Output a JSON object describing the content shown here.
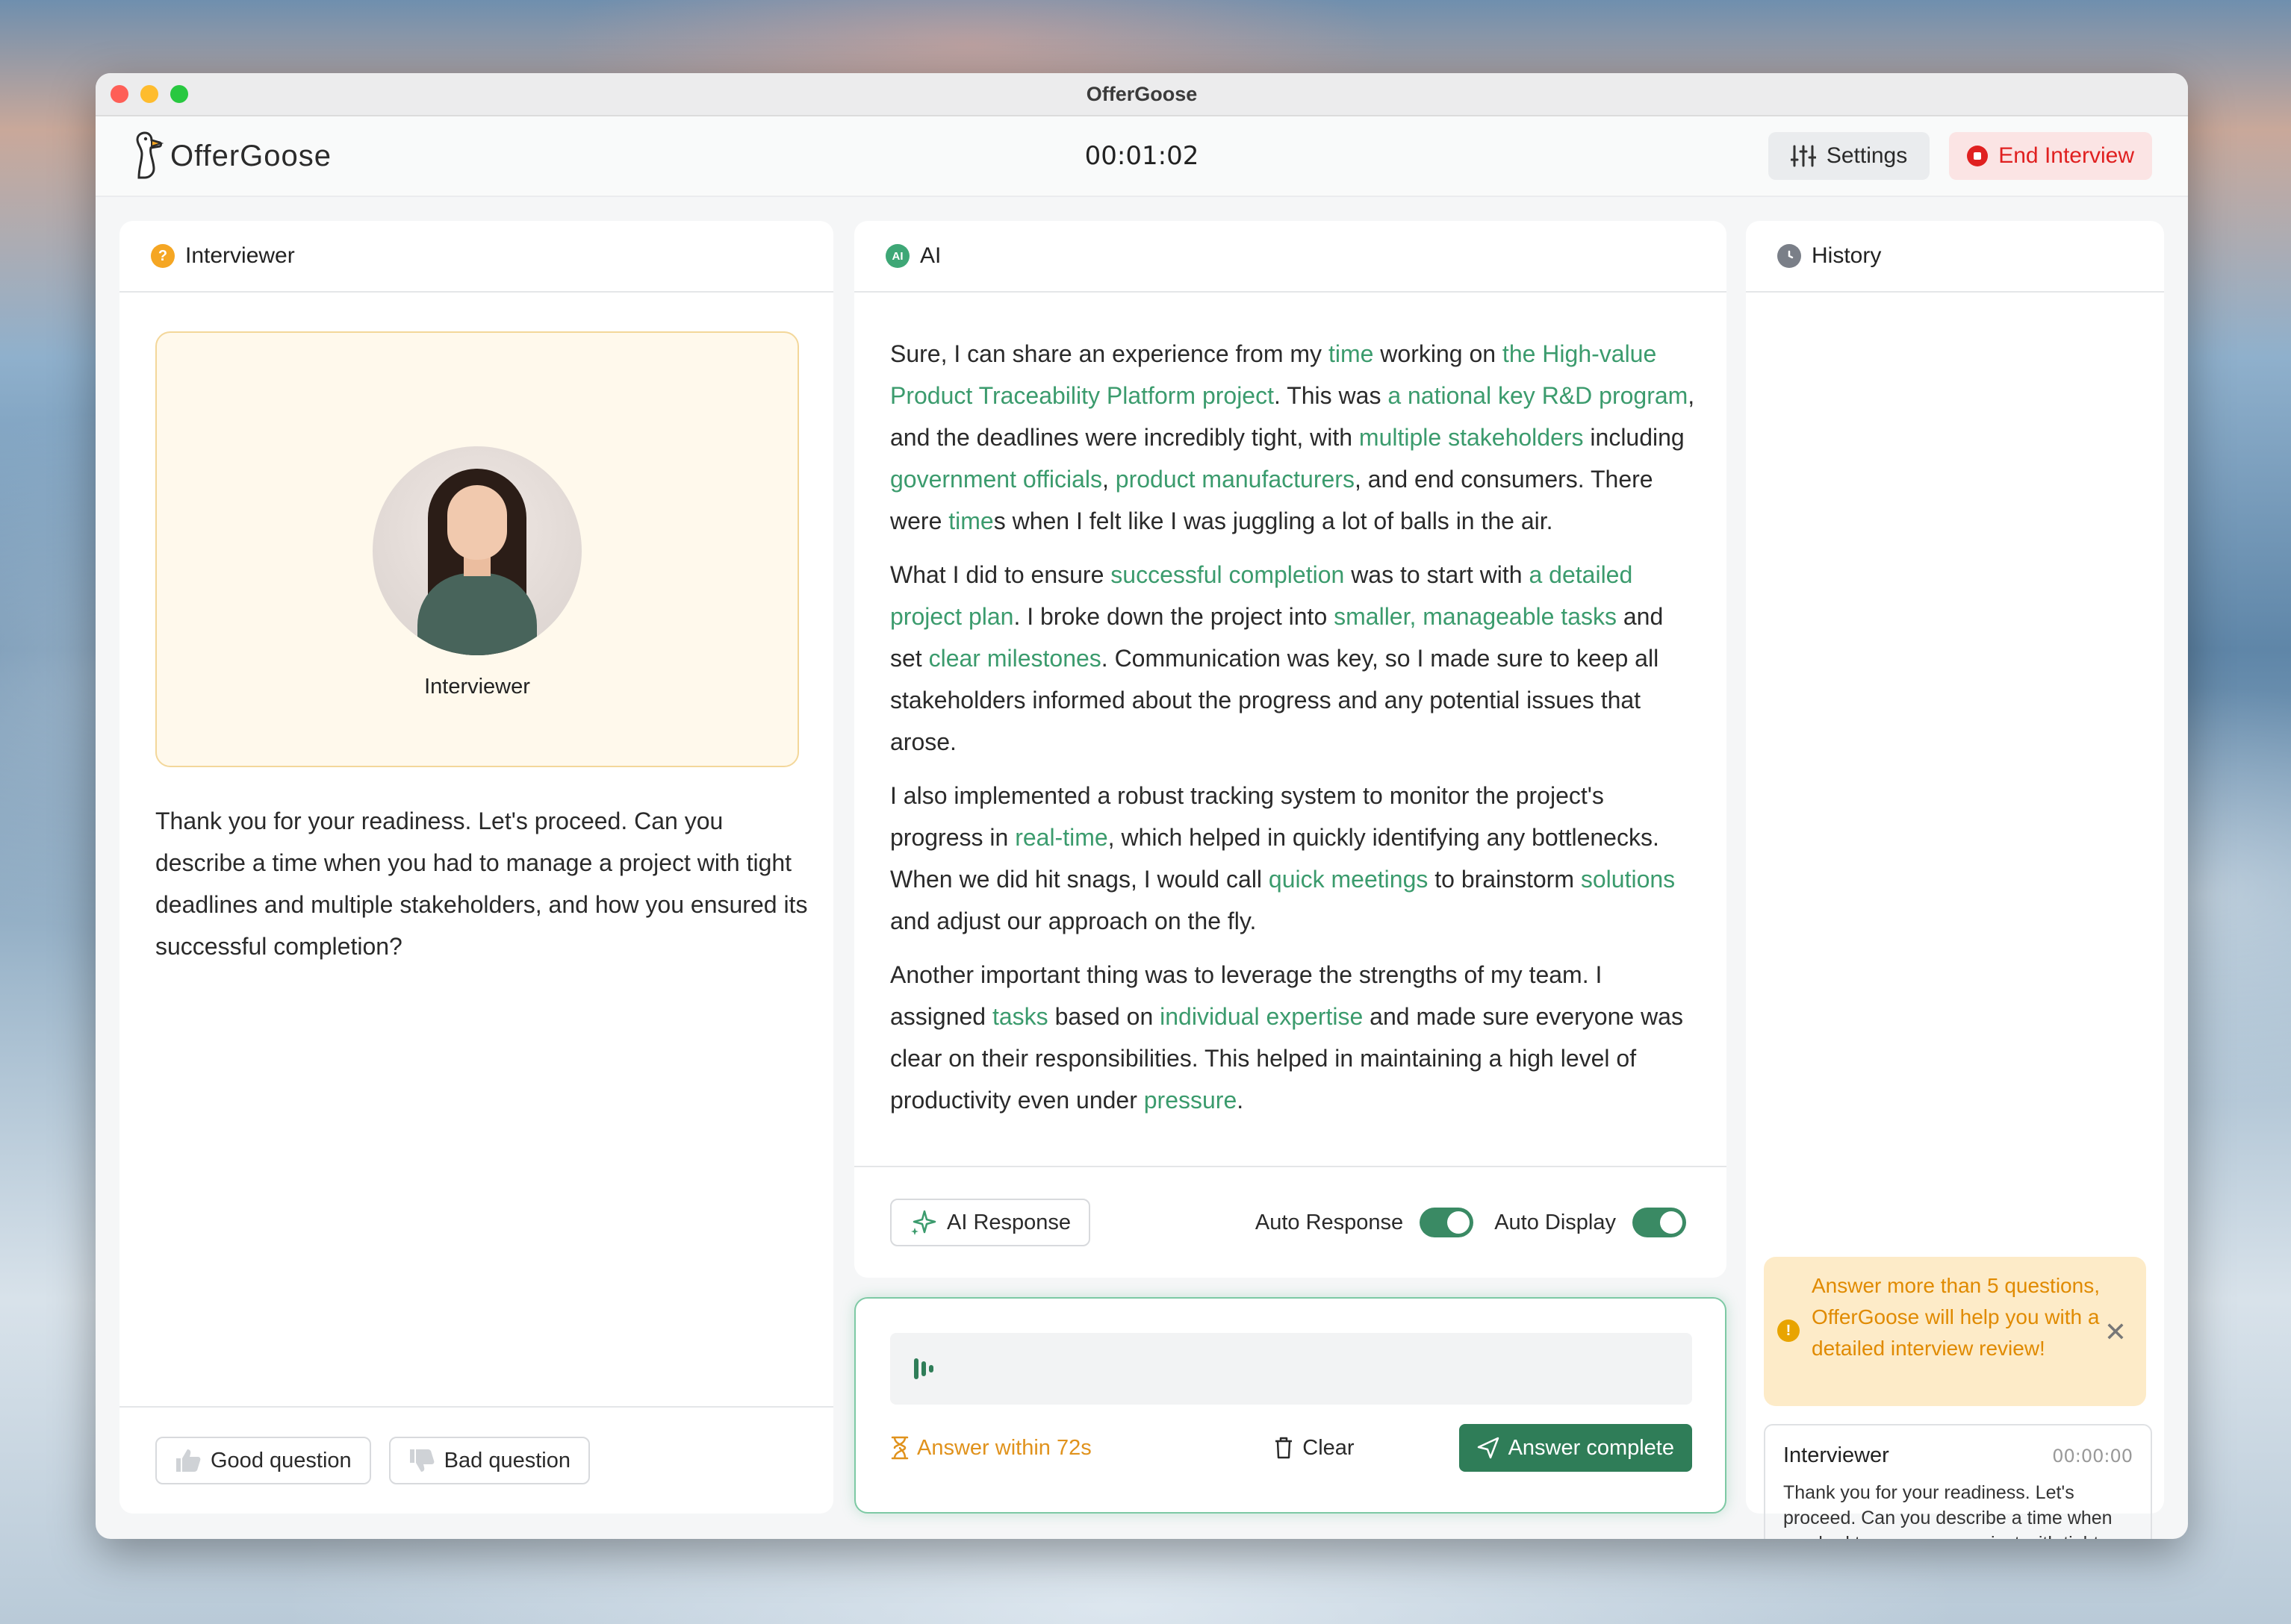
{
  "window": {
    "title": "OfferGoose"
  },
  "app": {
    "brand": "OfferGoose",
    "timer": "00:01:02",
    "settings_label": "Settings",
    "end_label": "End Interview"
  },
  "interviewer_panel": {
    "title": "Interviewer",
    "avatar_label": "Interviewer",
    "question": "Thank you for your readiness. Let's proceed. Can you describe a time when you had to manage a project with tight deadlines and multiple stakeholders, and how you ensured its successful completion?",
    "good_label": "Good question",
    "bad_label": "Bad question"
  },
  "ai_panel": {
    "title": "AI",
    "paragraphs": [
      [
        {
          "t": "Sure, I can share an experience from my "
        },
        {
          "t": "time",
          "h": true
        },
        {
          "t": " working on "
        },
        {
          "t": "the High-value Product Traceability Platform project",
          "h": true
        },
        {
          "t": ". This was "
        },
        {
          "t": "a national key R&D program",
          "h": true
        },
        {
          "t": ", and the deadlines were incredibly tight, with "
        },
        {
          "t": "multiple stakeholders",
          "h": true
        },
        {
          "t": " including "
        },
        {
          "t": "government officials",
          "h": true
        },
        {
          "t": ", "
        },
        {
          "t": "product manufacturers",
          "h": true
        },
        {
          "t": ", and end consumers. There were "
        },
        {
          "t": "time",
          "h": true
        },
        {
          "t": "s when I felt like I was juggling a lot of balls in the air."
        }
      ],
      [
        {
          "t": "What I did to ensure "
        },
        {
          "t": "successful completion",
          "h": true
        },
        {
          "t": " was to start with "
        },
        {
          "t": "a detailed project plan",
          "h": true
        },
        {
          "t": ". I broke down the project into "
        },
        {
          "t": "smaller, manageable tasks",
          "h": true
        },
        {
          "t": " and set "
        },
        {
          "t": "clear milestones",
          "h": true
        },
        {
          "t": ". Communication was key, so I made sure to keep all stakeholders informed about the progress and any potential issues that arose."
        }
      ],
      [
        {
          "t": "I also implemented a robust tracking system to monitor the project's progress in "
        },
        {
          "t": "real-time",
          "h": true
        },
        {
          "t": ", which helped in quickly identifying any bottlenecks. When we did hit snags, I would call "
        },
        {
          "t": "quick meetings",
          "h": true
        },
        {
          "t": " to brainstorm "
        },
        {
          "t": "solutions",
          "h": true
        },
        {
          "t": " and adjust our approach on the fly."
        }
      ],
      [
        {
          "t": "Another important thing was to leverage the strengths of my team. I assigned "
        },
        {
          "t": "tasks",
          "h": true
        },
        {
          "t": " based on "
        },
        {
          "t": "individual expertise",
          "h": true
        },
        {
          "t": " and made sure everyone was clear on their responsibilities. This helped in maintaining a high level of productivity even under "
        },
        {
          "t": "pressure",
          "h": true
        },
        {
          "t": "."
        }
      ]
    ],
    "ai_response_label": "AI Response",
    "auto_response_label": "Auto Response",
    "auto_response_on": true,
    "auto_display_label": "Auto Display",
    "auto_display_on": true
  },
  "answer": {
    "countdown_label": "Answer within 72s",
    "clear_label": "Clear",
    "complete_label": "Answer complete"
  },
  "history_panel": {
    "title": "History",
    "notice": "Answer more than 5 questions, OfferGoose will help you with a detailed interview review!",
    "items": [
      {
        "who": "Interviewer",
        "time": "00:00:00",
        "text": "Thank you for your readiness. Let's proceed. Can you describe a time when you had to manage a project with tight..."
      }
    ]
  },
  "colors": {
    "accent_green": "#3b9b6d",
    "primary_button": "#2f7d58",
    "danger": "#e02020",
    "warning": "#e08a00"
  }
}
